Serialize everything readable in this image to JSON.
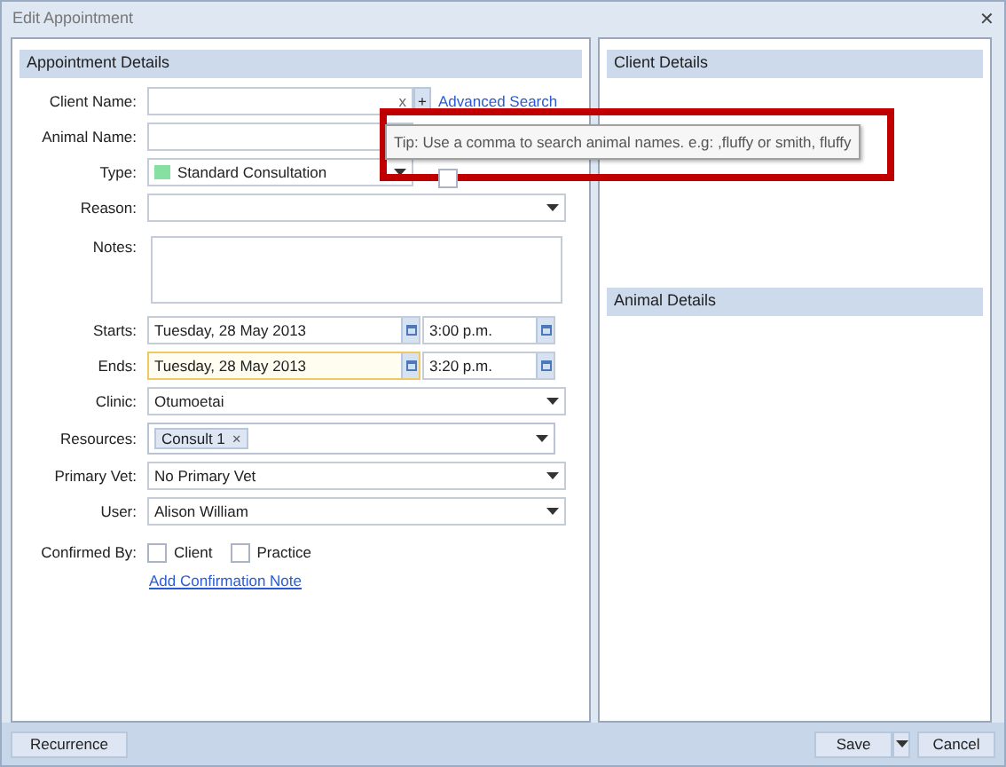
{
  "window": {
    "title": "Edit Appointment",
    "close": "✕"
  },
  "appointment_details": {
    "title": "Appointment Details",
    "client_name": {
      "label": "Client Name:",
      "clear": "x",
      "add": "+",
      "link": "Advanced Search"
    },
    "animal_name": {
      "label": "Animal Name:"
    },
    "type": {
      "label": "Type:",
      "value": "Standard Consultation",
      "color": "#86e0a0"
    },
    "walk_in": {
      "checked": false
    },
    "reason": {
      "label": "Reason:"
    },
    "notes": {
      "label": "Notes:"
    },
    "starts": {
      "label": "Starts:",
      "date": "Tuesday, 28 May 2013",
      "time": "3:00 p.m.",
      "focused": false
    },
    "ends": {
      "label": "Ends:",
      "date": "Tuesday, 28 May 2013",
      "time": "3:20 p.m.",
      "focused": true
    },
    "clinic": {
      "label": "Clinic:",
      "value": "Otumoetai"
    },
    "resources": {
      "label": "Resources:",
      "tags": [
        {
          "text": "Consult 1",
          "remove": "×"
        }
      ]
    },
    "primary_vet": {
      "label": "Primary Vet:",
      "value": "No Primary Vet"
    },
    "user": {
      "label": "User:",
      "value": "Alison William"
    },
    "confirmed_by": {
      "label": "Confirmed By:",
      "options": [
        {
          "label": "Client",
          "checked": false
        },
        {
          "label": "Practice",
          "checked": false
        }
      ],
      "link": "Add Confirmation Note"
    }
  },
  "tooltip": {
    "text": "Tip: Use a comma to search animal names. e.g: ,fluffy or smith, fluffy"
  },
  "client_details": {
    "title": "Client Details"
  },
  "animal_details": {
    "title": "Animal Details"
  },
  "footer": {
    "buttons": [
      {
        "label": "Recurrence"
      }
    ],
    "save": "Save",
    "cancel": "Cancel"
  }
}
